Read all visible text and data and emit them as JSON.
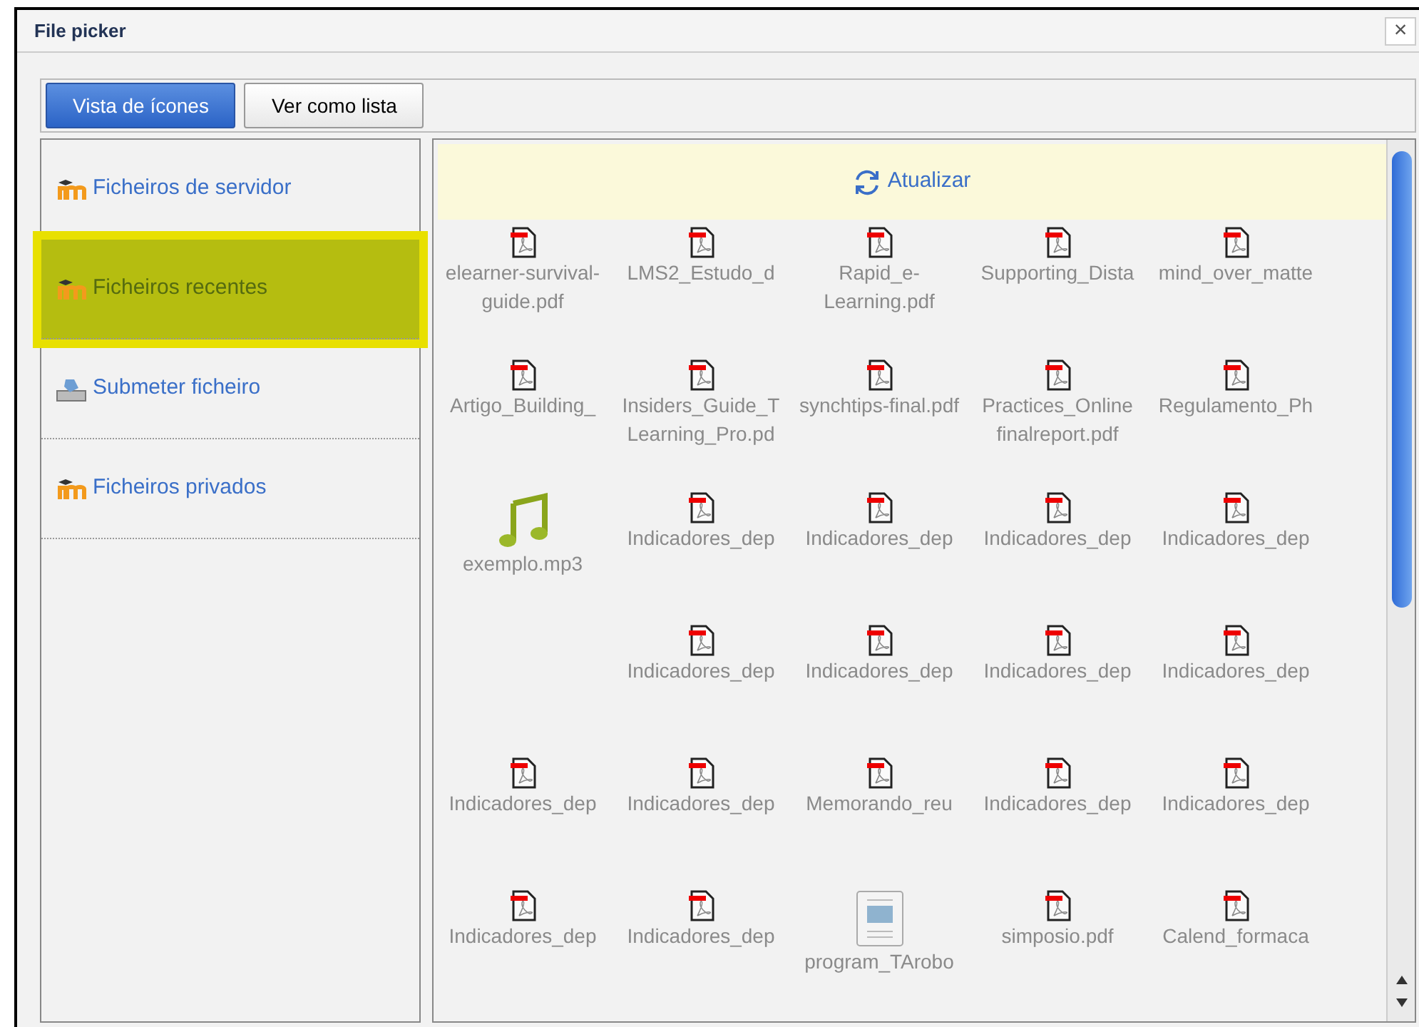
{
  "window": {
    "title": "File picker",
    "close": "×"
  },
  "view_tabs": [
    {
      "label": "Vista de ícones",
      "selected": true
    },
    {
      "label": "Ver como lista",
      "selected": false
    }
  ],
  "sidebar": {
    "items": [
      {
        "label": "Ficheiros de servidor",
        "kind": "moodle",
        "selected": false
      },
      {
        "label": "Ficheiros recentes",
        "kind": "moodle",
        "selected": true
      },
      {
        "label": "Submeter ficheiro",
        "kind": "upload",
        "selected": false
      },
      {
        "label": "Ficheiros privados",
        "kind": "moodle",
        "selected": false
      }
    ]
  },
  "refresh": {
    "label": "Atualizar"
  },
  "file_rows": [
    [
      {
        "name": "elearner-survival-guide.pdf",
        "kind": "pdf"
      },
      {
        "name": "LMS2_Estudo_d",
        "kind": "pdf"
      },
      {
        "name": "Rapid_e-Learning.pdf",
        "kind": "pdf"
      },
      {
        "name": "Supporting_Dista",
        "kind": "pdf"
      },
      {
        "name": "mind_over_matte",
        "kind": "pdf"
      }
    ],
    [
      {
        "name": "Artigo_Building_",
        "kind": "pdf"
      },
      {
        "name": "Insiders_Guide_T Learning_Pro.pd",
        "kind": "pdf"
      },
      {
        "name": "synchtips-final.pdf",
        "kind": "pdf"
      },
      {
        "name": "Practices_Online finalreport.pdf",
        "kind": "pdf"
      },
      {
        "name": "Regulamento_Ph",
        "kind": "pdf"
      }
    ],
    [
      {
        "name": "exemplo.mp3",
        "kind": "audio"
      },
      {
        "name": "Indicadores_dep",
        "kind": "pdf"
      },
      {
        "name": "Indicadores_dep",
        "kind": "pdf"
      },
      {
        "name": "Indicadores_dep",
        "kind": "pdf"
      },
      {
        "name": "Indicadores_dep",
        "kind": "pdf"
      }
    ],
    [
      null,
      {
        "name": "Indicadores_dep",
        "kind": "pdf"
      },
      {
        "name": "Indicadores_dep",
        "kind": "pdf"
      },
      {
        "name": "Indicadores_dep",
        "kind": "pdf"
      },
      {
        "name": "Indicadores_dep",
        "kind": "pdf"
      }
    ],
    [
      {
        "name": "Indicadores_dep",
        "kind": "pdf"
      },
      {
        "name": "Indicadores_dep",
        "kind": "pdf"
      },
      {
        "name": "Memorando_reu",
        "kind": "pdf"
      },
      {
        "name": "Indicadores_dep",
        "kind": "pdf"
      },
      {
        "name": "Indicadores_dep",
        "kind": "pdf"
      }
    ],
    [
      {
        "name": "Indicadores_dep",
        "kind": "pdf"
      },
      {
        "name": "Indicadores_dep",
        "kind": "pdf"
      },
      {
        "name": "program_TArobo",
        "kind": "image"
      },
      {
        "name": "simposio.pdf",
        "kind": "pdf"
      },
      {
        "name": "Calend_formaca",
        "kind": "pdf"
      }
    ]
  ]
}
